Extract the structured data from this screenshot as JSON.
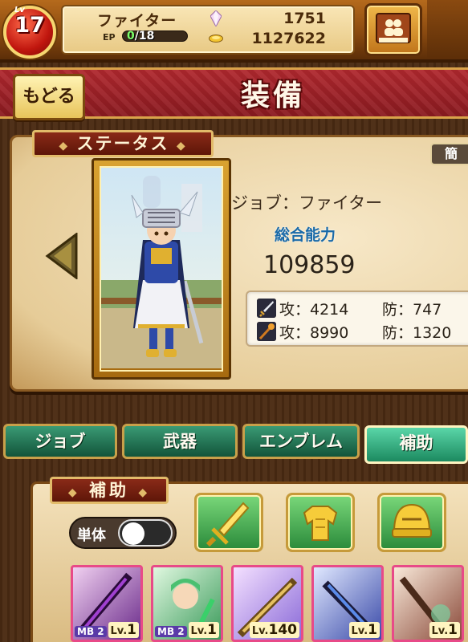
{
  "player": {
    "level_label": "Lv",
    "level": "17",
    "job": "ファイター",
    "ep_label": "EP",
    "ep_current": "0",
    "ep_max": "/18",
    "gems": "1751",
    "coins": "1127622"
  },
  "header": {
    "back_label": "もどる",
    "title": "装備"
  },
  "status": {
    "tab_label": "ステータス",
    "simple_label": "簡",
    "job_line": "ジョブ：ファイター",
    "overall_label": "総合能力",
    "overall_value": "109859",
    "rows": [
      {
        "icon": "sword-icon",
        "attack": "攻：4214",
        "defense": "防：747"
      },
      {
        "icon": "staff-icon",
        "attack": "攻：8990",
        "defense": "防：1320"
      }
    ]
  },
  "tabs": [
    {
      "label": "ジョブ",
      "active": false
    },
    {
      "label": "武器",
      "active": false
    },
    {
      "label": "エンブレム",
      "active": false
    },
    {
      "label": "補助",
      "active": true
    }
  ],
  "support": {
    "tab_label": "補助",
    "single_label": "単体",
    "single_on": false,
    "categories": [
      "sword-category-icon",
      "armor-category-icon",
      "helmet-category-icon"
    ],
    "cards": [
      {
        "mb": "MB 2",
        "lv_prefix": "Lv.",
        "lv": "1",
        "color": "#6a2a8a"
      },
      {
        "mb": "MB 2",
        "lv_prefix": "Lv.",
        "lv": "1",
        "color": "#3a9a5a"
      },
      {
        "mb": "",
        "lv_prefix": "Lv.",
        "lv": "140",
        "color": "#8a6ad8"
      },
      {
        "mb": "",
        "lv_prefix": "Lv.",
        "lv": "1",
        "color": "#3a4aa8"
      },
      {
        "mb": "",
        "lv_prefix": "Lv.",
        "lv": "1",
        "color": "#8a4a3a"
      }
    ]
  }
}
